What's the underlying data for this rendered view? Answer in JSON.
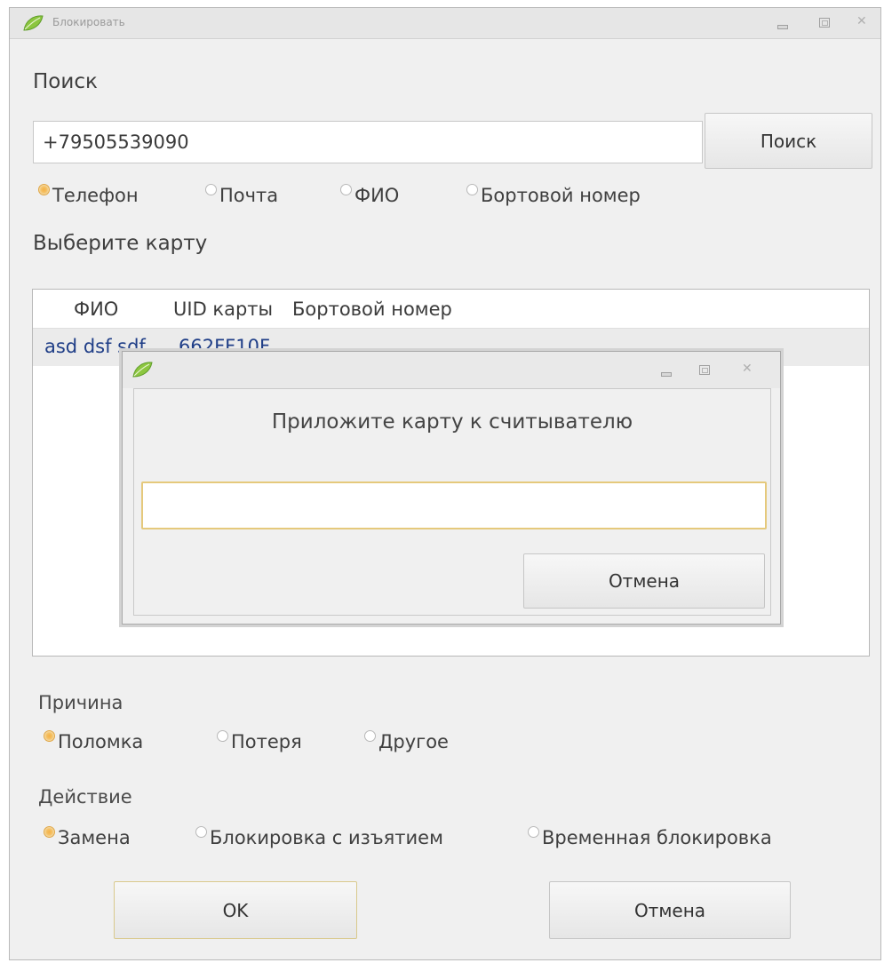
{
  "window": {
    "title": "Блокировать"
  },
  "search": {
    "section_label": "Поиск",
    "input_value": "+79505539090",
    "button_label": "Поиск",
    "type_options": [
      {
        "label": "Телефон",
        "selected": true
      },
      {
        "label": "Почта",
        "selected": false
      },
      {
        "label": "ФИО",
        "selected": false
      },
      {
        "label": "Бортовой номер",
        "selected": false
      }
    ]
  },
  "cards": {
    "section_label": "Выберите карту",
    "columns": [
      "ФИО",
      "UID карты",
      "Бортовой номер"
    ],
    "rows": [
      {
        "fio": "asd dsf sdf",
        "uid": "662FF10F",
        "board": ""
      }
    ]
  },
  "dialog": {
    "message": "Приложите карту к считывателю",
    "input_value": "",
    "cancel_label": "Отмена"
  },
  "reason": {
    "label": "Причина",
    "options": [
      {
        "label": "Поломка",
        "selected": true
      },
      {
        "label": "Потеря",
        "selected": false
      },
      {
        "label": "Другое",
        "selected": false
      }
    ]
  },
  "action": {
    "label": "Действие",
    "options": [
      {
        "label": "Замена",
        "selected": true
      },
      {
        "label": "Блокировка с изъятием",
        "selected": false
      },
      {
        "label": "Временная блокировка",
        "selected": false
      }
    ]
  },
  "footer": {
    "ok_label": "OK",
    "cancel_label": "Отмена"
  },
  "colors": {
    "accent": "#f3b046",
    "link_text": "#1f3e87"
  },
  "icons": {
    "app": "leaf-icon"
  }
}
